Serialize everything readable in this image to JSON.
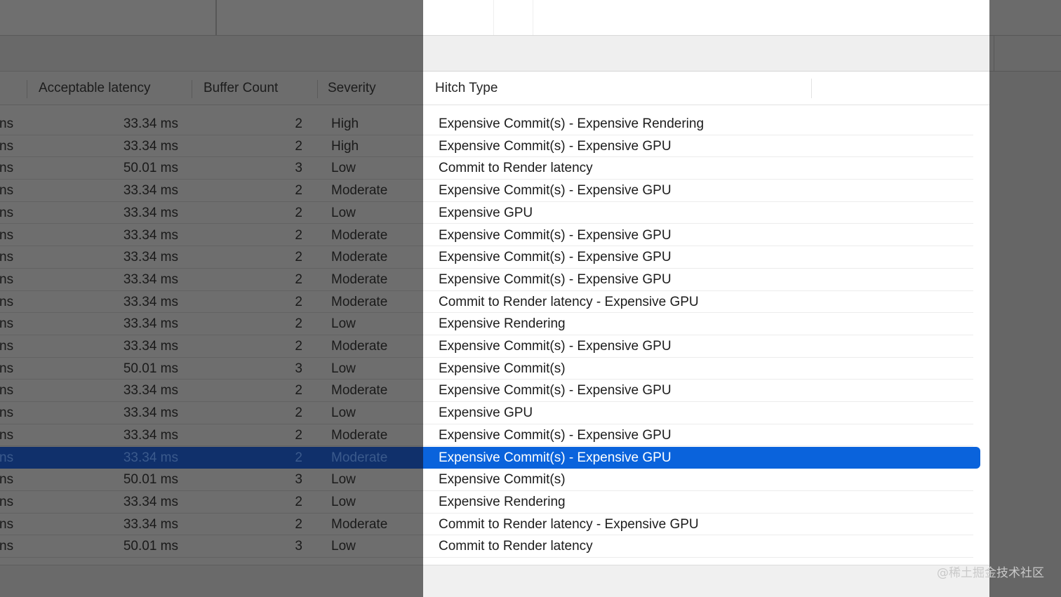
{
  "left_header": {
    "acceptable_latency": "Acceptable latency",
    "buffer_count": "Buffer Count",
    "severity": "Severity"
  },
  "right_header": {
    "hitch_type": "Hitch Type"
  },
  "truncated_prefix": "ns",
  "selected_row_index": 15,
  "rows": [
    {
      "latency": "33.34 ms",
      "buffers": "2",
      "severity": "High",
      "hitch": "Expensive Commit(s) - Expensive Rendering"
    },
    {
      "latency": "33.34 ms",
      "buffers": "2",
      "severity": "High",
      "hitch": "Expensive Commit(s) - Expensive GPU"
    },
    {
      "latency": "50.01 ms",
      "buffers": "3",
      "severity": "Low",
      "hitch": "Commit to Render latency"
    },
    {
      "latency": "33.34 ms",
      "buffers": "2",
      "severity": "Moderate",
      "hitch": "Expensive Commit(s) - Expensive GPU"
    },
    {
      "latency": "33.34 ms",
      "buffers": "2",
      "severity": "Low",
      "hitch": "Expensive GPU"
    },
    {
      "latency": "33.34 ms",
      "buffers": "2",
      "severity": "Moderate",
      "hitch": "Expensive Commit(s) - Expensive GPU"
    },
    {
      "latency": "33.34 ms",
      "buffers": "2",
      "severity": "Moderate",
      "hitch": "Expensive Commit(s) - Expensive GPU"
    },
    {
      "latency": "33.34 ms",
      "buffers": "2",
      "severity": "Moderate",
      "hitch": "Expensive Commit(s) - Expensive GPU"
    },
    {
      "latency": "33.34 ms",
      "buffers": "2",
      "severity": "Moderate",
      "hitch": "Commit to Render latency - Expensive GPU"
    },
    {
      "latency": "33.34 ms",
      "buffers": "2",
      "severity": "Low",
      "hitch": "Expensive Rendering"
    },
    {
      "latency": "33.34 ms",
      "buffers": "2",
      "severity": "Moderate",
      "hitch": "Expensive Commit(s) - Expensive GPU"
    },
    {
      "latency": "50.01 ms",
      "buffers": "3",
      "severity": "Low",
      "hitch": "Expensive Commit(s)"
    },
    {
      "latency": "33.34 ms",
      "buffers": "2",
      "severity": "Moderate",
      "hitch": "Expensive Commit(s) - Expensive GPU"
    },
    {
      "latency": "33.34 ms",
      "buffers": "2",
      "severity": "Low",
      "hitch": "Expensive GPU"
    },
    {
      "latency": "33.34 ms",
      "buffers": "2",
      "severity": "Moderate",
      "hitch": "Expensive Commit(s) - Expensive GPU"
    },
    {
      "latency": "33.34 ms",
      "buffers": "2",
      "severity": "Moderate",
      "hitch": "Expensive Commit(s) - Expensive GPU"
    },
    {
      "latency": "50.01 ms",
      "buffers": "3",
      "severity": "Low",
      "hitch": "Expensive Commit(s)"
    },
    {
      "latency": "33.34 ms",
      "buffers": "2",
      "severity": "Low",
      "hitch": "Expensive Rendering"
    },
    {
      "latency": "33.34 ms",
      "buffers": "2",
      "severity": "Moderate",
      "hitch": "Commit to Render latency - Expensive GPU"
    },
    {
      "latency": "50.01 ms",
      "buffers": "3",
      "severity": "Low",
      "hitch": "Commit to Render latency"
    }
  ],
  "watermark": "@稀土掘金技术社区",
  "colors": {
    "selection_blue": "#0a63dc",
    "dim_selection": "#10306b",
    "dim_background": "#6e6e6e",
    "panel_background": "#ffffff"
  }
}
